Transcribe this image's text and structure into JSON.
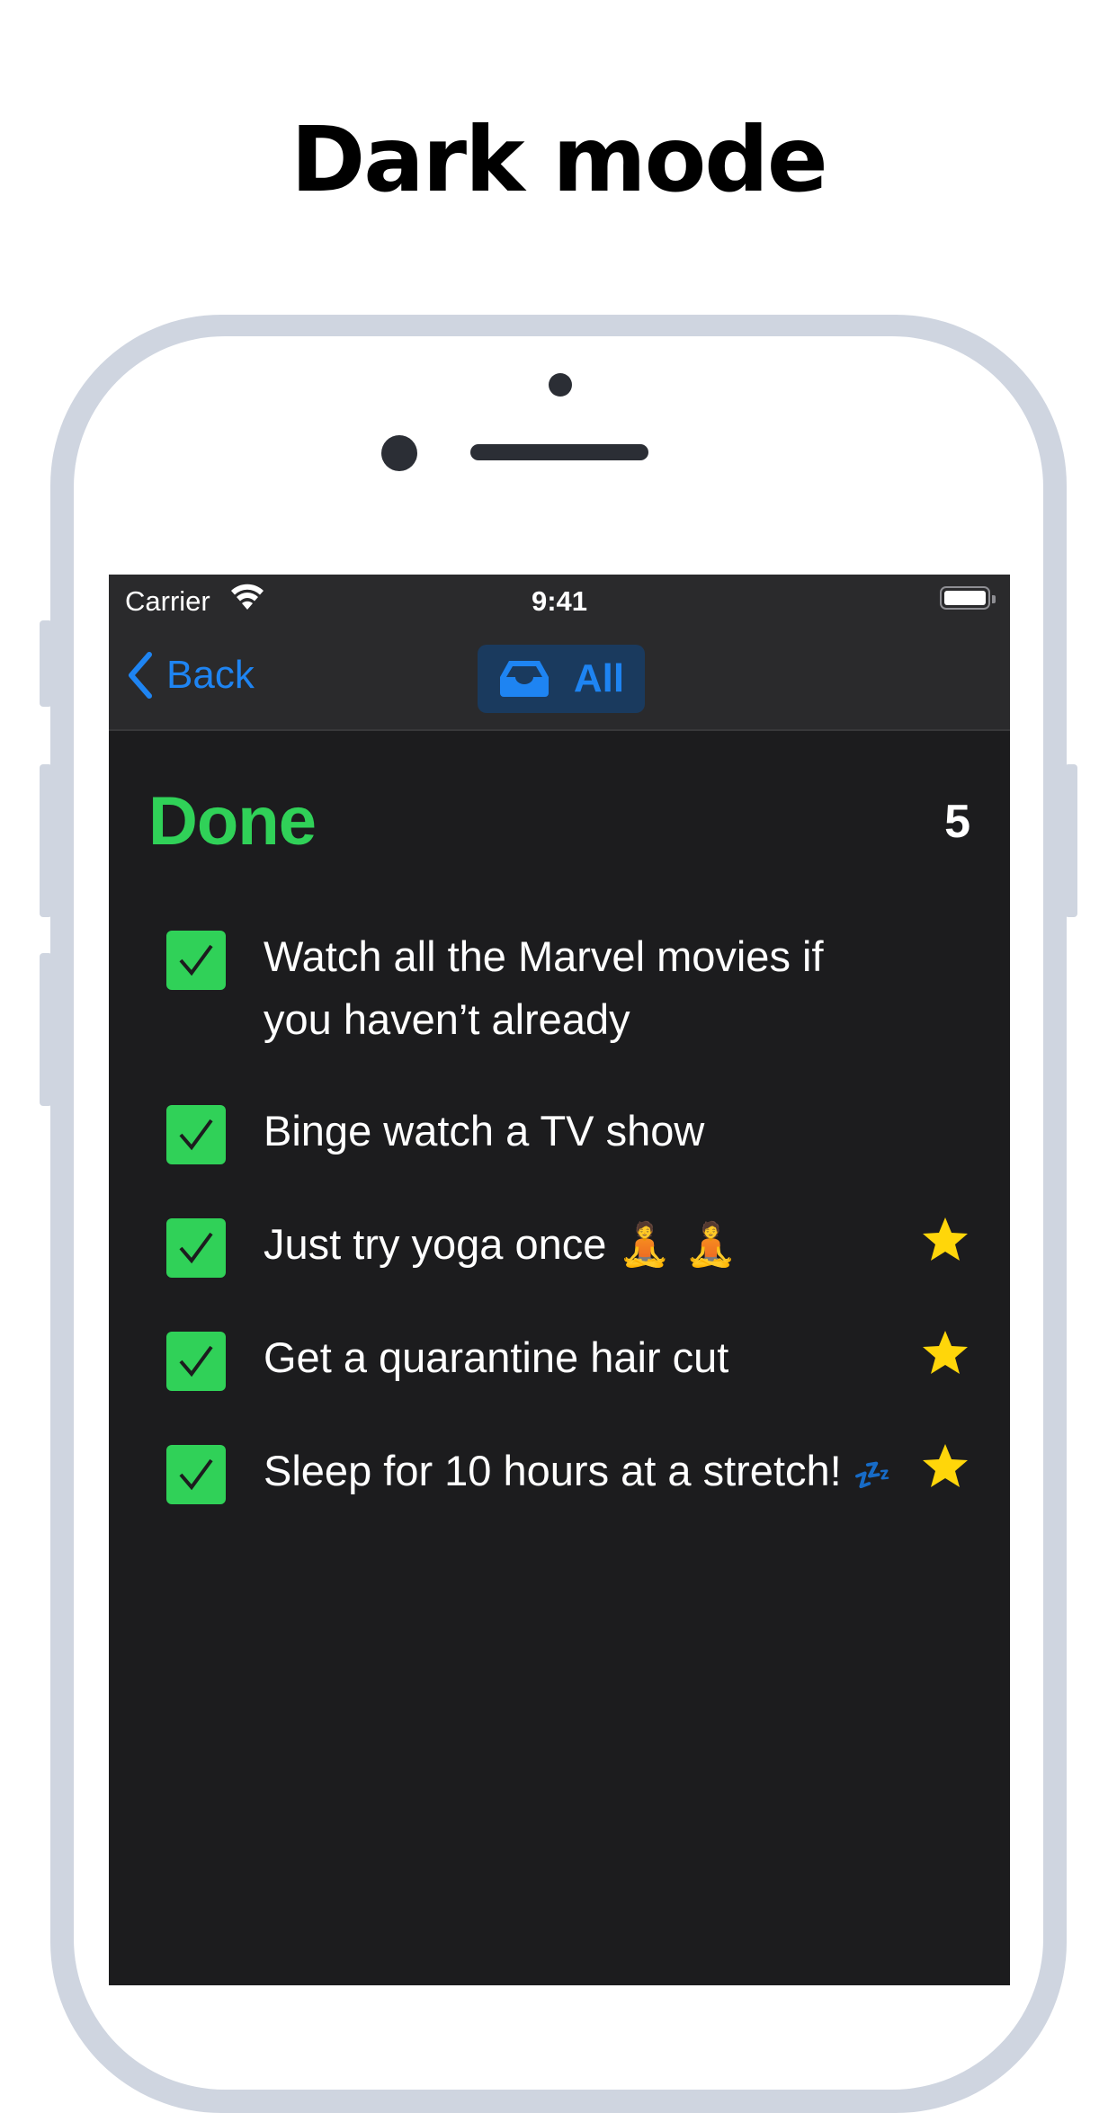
{
  "headline": "Dark mode",
  "status_bar": {
    "carrier": "Carrier",
    "time": "9:41"
  },
  "nav": {
    "back_label": "Back",
    "scope_label": "All"
  },
  "section": {
    "title": "Done",
    "count": "5"
  },
  "items": [
    {
      "text": "Watch all the Marvel movies if you haven’t already",
      "checked": true,
      "starred": false
    },
    {
      "text": "Binge watch a TV show",
      "checked": true,
      "starred": false
    },
    {
      "text": "Just try yoga once",
      "emoji": "🧘 🧘",
      "checked": true,
      "starred": true
    },
    {
      "text": "Get a quarantine hair cut",
      "checked": true,
      "starred": true
    },
    {
      "text": "Sleep for 10 hours at a stretch!",
      "emoji": "💤",
      "checked": true,
      "starred": true
    }
  ],
  "colors": {
    "accent_blue": "#1e84f2",
    "done_green": "#30d158",
    "star_yellow": "#ffd60a",
    "background": "#1c1c1e"
  },
  "icons": {
    "back": "chevron-left-icon",
    "scope": "tray-icon",
    "check": "checkmark-icon",
    "star": "star-icon",
    "wifi": "wifi-icon",
    "battery": "battery-icon"
  }
}
